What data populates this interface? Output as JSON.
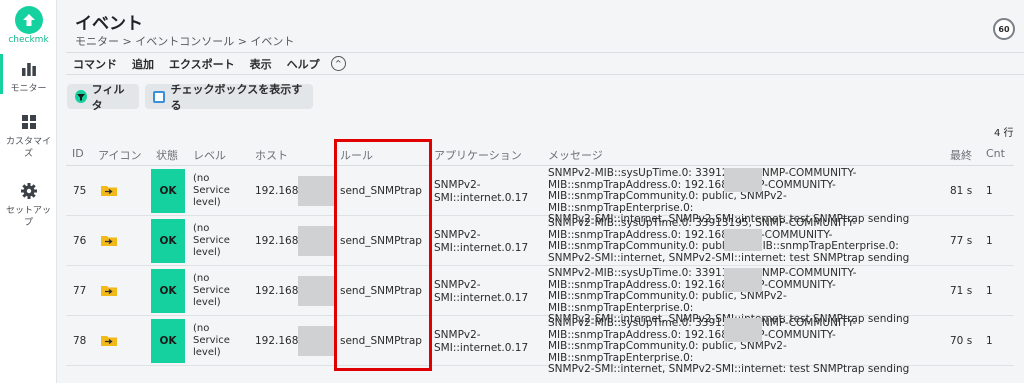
{
  "logo": {
    "text": "checkmk"
  },
  "sidebar": {
    "items": [
      {
        "label": "モニター",
        "icon": "bar-chart-icon"
      },
      {
        "label": "カスタマイズ",
        "icon": "grid-icon"
      },
      {
        "label": "セットアップ",
        "icon": "gear-icon"
      }
    ]
  },
  "header": {
    "title": "イベント",
    "breadcrumb": "モニター > イベントコンソール > イベント",
    "refresh_seconds": "60"
  },
  "menubar": {
    "items": [
      "コマンド",
      "追加",
      "エクスポート",
      "表示",
      "ヘルプ"
    ],
    "toggle": "^"
  },
  "buttons": {
    "filter": "フィルタ",
    "show_checkboxes": "チェックボックスを表示する"
  },
  "table": {
    "row_count": "4 行",
    "headers": {
      "id": "ID",
      "icon": "アイコン",
      "state": "状態",
      "level": "レベル",
      "host": "ホスト",
      "rule": "ルール",
      "application": "アプリケーション",
      "message": "メッセージ",
      "last": "最終",
      "count": "Cnt"
    },
    "rows": [
      {
        "id": "75",
        "state": "OK",
        "level": [
          "(no",
          "Service",
          "level)"
        ],
        "host": "192.168.",
        "rule": "send_SNMPtrap",
        "application": [
          "SNMPv2-",
          "SMI::internet.0.17"
        ],
        "message": [
          "SNMPv2-MIB::sysUpTime.0: 33912748, SNMP-COMMUNITY-",
          "MIB::snmpTrapAddress.0: 192.168.          SNMP-COMMUNITY-",
          "MIB::snmpTrapCommunity.0: public, SNMPv2-MIB::snmpTrapEnterprise.0:",
          "SNMPv2-SMI::internet, SNMPv2-SMI::internet: test SNMPtrap sending"
        ],
        "last": "81 s",
        "count": "1"
      },
      {
        "id": "76",
        "state": "OK",
        "level": [
          "(no",
          "Service",
          "level)"
        ],
        "host": "192.168.",
        "rule": "send_SNMPtrap",
        "application": [
          "SNMPv2-",
          "SMI::internet.0.17"
        ],
        "message": [
          "SNMPv2-MIB::sysUpTime.0: 33913195, SNMP-COMMUNITY-",
          "MIB::snmpTrapAddress.0: 192.168           SNMP-COMMUNITY-",
          "MIB::snmpTrapCommunity.0: public          v2-MIB::snmpTrapEnterprise.0:",
          "SNMPv2-SMI::internet, SNMPv2-SMI::internet: test SNMPtrap sending"
        ],
        "last": "77 s",
        "count": "1"
      },
      {
        "id": "77",
        "state": "OK",
        "level": [
          "(no",
          "Service",
          "level)"
        ],
        "host": "192.168.",
        "rule": "send_SNMPtrap",
        "application": [
          "SNMPv2-",
          "SMI::internet.0.17"
        ],
        "message": [
          "SNMPv2-MIB::sysUpTime.0: 33913787, SNMP-COMMUNITY-",
          "MIB::snmpTrapAddress.0: 192.168.          SNMP-COMMUNITY-",
          "MIB::snmpTrapCommunity.0: public, SNMPv2-MIB::snmpTrapEnterprise.0:",
          "SNMPv2-SMI::internet, SNMPv2-SMI::internet: test SNMPtrap sending"
        ],
        "last": "71 s",
        "count": "1"
      },
      {
        "id": "78",
        "state": "OK",
        "level": [
          "(no",
          "Service",
          "level)"
        ],
        "host": "192.168",
        "rule": "send_SNMPtrap",
        "application": [
          "SNMPv2-",
          "SMI::internet.0.17"
        ],
        "message": [
          "SNMPv2-MIB::sysUpTime.0: 33913867, SNMP-COMMUNITY-",
          "MIB::snmpTrapAddress.0: 192.168.          SNMP-COMMUNITY-",
          "MIB::snmpTrapCommunity.0: public, SNMPv2-MIB::snmpTrapEnterprise.0:",
          "SNMPv2-SMI::internet, SNMPv2-SMI::internet: test SNMPtrap sending"
        ],
        "last": "70 s",
        "count": "1"
      }
    ]
  },
  "colors": {
    "accent": "#15d1a0",
    "highlight": "#e00000",
    "ok": "#15d1a0"
  }
}
